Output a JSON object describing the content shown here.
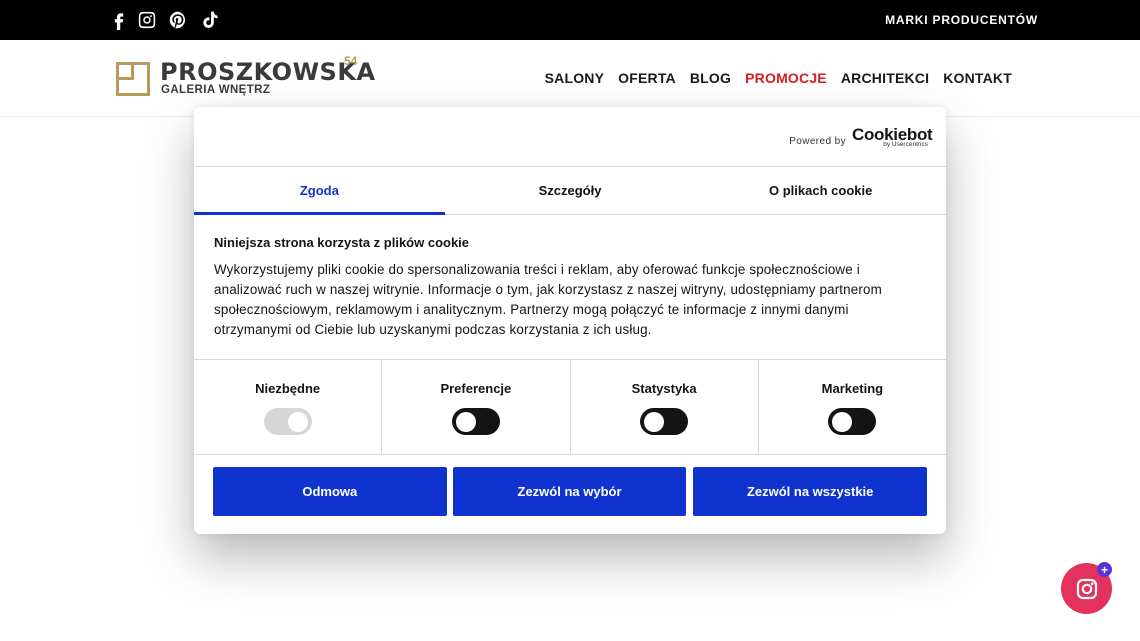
{
  "topbar": {
    "social_icons": [
      "facebook-icon",
      "instagram-icon",
      "pinterest-icon",
      "tiktok-icon"
    ],
    "brands_link": "MARKI PRODUCENTÓW"
  },
  "header": {
    "logo": {
      "name": "PROSZKOWSKA",
      "number": "54",
      "subtitle": "GALERIA WNĘTRZ"
    },
    "nav": [
      "SALONY",
      "OFERTA",
      "BLOG",
      "PROMOCJE",
      "ARCHITEKCI",
      "KONTAKT"
    ]
  },
  "cookie_dialog": {
    "powered_by": "Powered by",
    "cookiebot_brand": "Cookiebot",
    "cookiebot_sub": "by Usercentrics",
    "tabs": [
      {
        "label": "Zgoda",
        "active": true
      },
      {
        "label": "Szczegóły",
        "active": false
      },
      {
        "label": "O plikach cookie",
        "active": false
      }
    ],
    "title": "Niniejsza strona korzysta z plików cookie",
    "text": "Wykorzystujemy pliki cookie do spersonalizowania treści i reklam, aby oferować funkcje społecznościowe i analizować ruch w naszej witrynie. Informacje o tym, jak korzystasz z naszej witryny, udostępniamy partnerom społecznościowym, reklamowym i analitycznym. Partnerzy mogą połączyć te informacje z innymi danymi otrzymanymi od Ciebie lub uzyskanymi podczas korzystania z ich usług.",
    "toggles": [
      {
        "label": "Niezbędne",
        "enabled": true,
        "disabled": true
      },
      {
        "label": "Preferencje",
        "enabled": false,
        "disabled": false
      },
      {
        "label": "Statystyka",
        "enabled": false,
        "disabled": false
      },
      {
        "label": "Marketing",
        "enabled": false,
        "disabled": false
      }
    ],
    "buttons": {
      "deny": "Odmowa",
      "allow_selection": "Zezwól na wybór",
      "allow_all": "Zezwól na wszystkie"
    }
  },
  "floating": {
    "icon": "instagram-icon",
    "badge": "+"
  },
  "colors": {
    "accent": "#1032cf",
    "promo": "#d42020",
    "logo_gold": "#b89a5a",
    "fab": "#e3325b",
    "badge": "#5a32d6"
  }
}
